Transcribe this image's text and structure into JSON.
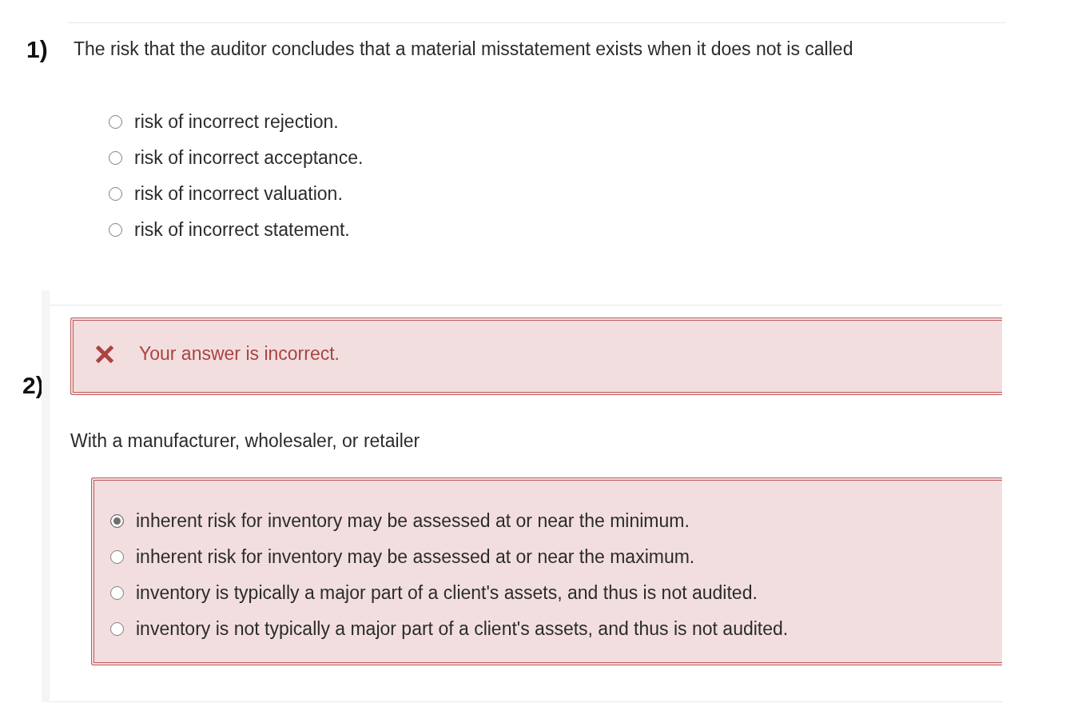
{
  "questions": [
    {
      "number": "1)",
      "prompt": "The risk that the auditor concludes that a material misstatement exists when it does not is called",
      "options": [
        {
          "text": "risk of incorrect rejection.",
          "selected": false
        },
        {
          "text": "risk of incorrect acceptance.",
          "selected": false
        },
        {
          "text": "risk of incorrect valuation.",
          "selected": false
        },
        {
          "text": "risk of incorrect statement.",
          "selected": false
        }
      ]
    },
    {
      "number": "2)",
      "feedback": {
        "correct": false,
        "text": "Your answer is incorrect."
      },
      "prompt": "With a manufacturer, wholesaler, or retailer",
      "options": [
        {
          "text": "inherent risk for inventory may be assessed at or near the minimum.",
          "selected": true
        },
        {
          "text": "inherent risk for inventory may be assessed at or near the maximum.",
          "selected": false
        },
        {
          "text": "inventory is typically a major part of a client's assets, and thus is not audited.",
          "selected": false
        },
        {
          "text": "inventory is not typically a major part of a client's assets, and thus is not audited.",
          "selected": false
        }
      ]
    }
  ]
}
